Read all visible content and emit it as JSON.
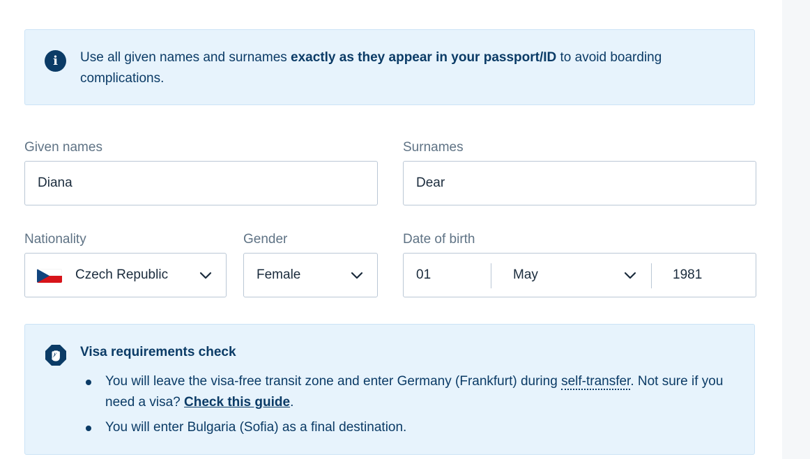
{
  "info_banner": {
    "icon": "info-icon",
    "text_before": "Use all given names and surnames ",
    "text_bold": "exactly as they appear in your passport/ID",
    "text_after": " to avoid boarding complications."
  },
  "form": {
    "given_names": {
      "label": "Given names",
      "value": "Diana"
    },
    "surnames": {
      "label": "Surnames",
      "value": "Dear"
    },
    "nationality": {
      "label": "Nationality",
      "value": "Czech Republic",
      "flag": "cz-flag-icon"
    },
    "gender": {
      "label": "Gender",
      "value": "Female"
    },
    "date_of_birth": {
      "label": "Date of birth",
      "day": "01",
      "month": "May",
      "year": "1981"
    }
  },
  "visa_check": {
    "icon": "stop-hand-icon",
    "title": "Visa requirements check",
    "items": [
      {
        "text_before": "You will leave the visa-free transit zone and enter Germany (Frankfurt) during ",
        "term": "self-transfer",
        "text_middle": ". Not sure if you need a visa? ",
        "link": "Check this guide",
        "text_after": "."
      },
      {
        "text": "You will enter Bulgaria (Sofia) as a final destination."
      }
    ]
  },
  "colors": {
    "banner_bg": "#e7f3fc",
    "primary_text": "#0b3b66",
    "label": "#5f7385",
    "input_border": "#bac7d5"
  }
}
